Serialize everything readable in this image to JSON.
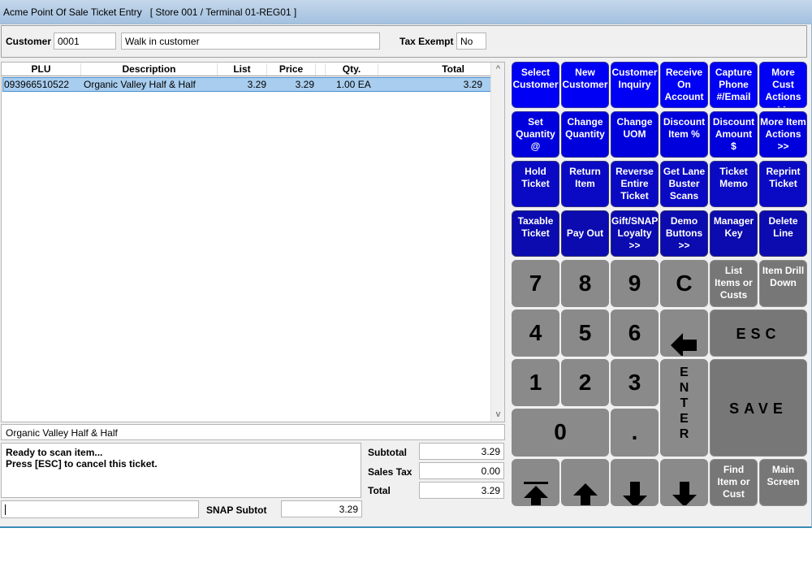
{
  "window": {
    "title": "Acme Point Of Sale Ticket Entry   [ Store 001 / Terminal 01-REG01 ]"
  },
  "customer": {
    "label": "Customer",
    "id": "0001",
    "name": "Walk in customer",
    "tax_exempt_label": "Tax Exempt",
    "tax_exempt_value": "No"
  },
  "grid": {
    "columns": [
      "PLU",
      "Description",
      "List",
      "Price",
      "Qty.",
      "Total"
    ],
    "rows": [
      {
        "plu": "093966510522",
        "description": "Organic Valley Half & Half",
        "list": "3.29",
        "price": "3.29",
        "qty": "1.00 EA",
        "total": "3.29"
      }
    ],
    "scroll_up": "^",
    "scroll_down": "v"
  },
  "selected_description": "Organic Valley Half & Half",
  "messages": {
    "line1": "Ready to scan item...",
    "line2": "Press [ESC] to cancel this ticket."
  },
  "scan_input": {
    "value": ""
  },
  "totals": {
    "subtotal_label": "Subtotal",
    "subtotal": "3.29",
    "sales_tax_label": "Sales Tax",
    "sales_tax": "0.00",
    "total_label": "Total",
    "total": "3.29",
    "snap_label": "SNAP Subtot",
    "snap": "3.29"
  },
  "function_buttons": {
    "row1": [
      "Select\nCustomer",
      "New\nCustomer",
      "Customer\nInquiry",
      "Receive\nOn\nAccount",
      "Capture\nPhone\n#/Email",
      "More Cust\nActions\n>>"
    ],
    "row2": [
      "Set\nQuantity\n@",
      "Change\nQuantity",
      "Change\nUOM",
      "Discount\nItem %",
      "Discount\nAmount\n$",
      "More Item\nActions\n>>"
    ],
    "row3": [
      "Hold\nTicket",
      "Return\nItem",
      "Reverse\nEntire\nTicket",
      "Get Lane\nBuster\nScans",
      "Ticket\nMemo",
      "Reprint\nTicket"
    ],
    "row4": [
      "Taxable\nTicket",
      "Pay Out",
      "Gift/SNAP\nLoyalty\n>>",
      "Demo\nButtons\n>>",
      "Manager\nKey",
      "Delete\nLine"
    ]
  },
  "keypad": {
    "k7": "7",
    "k8": "8",
    "k9": "9",
    "clear": "C",
    "list_items": "List\nItems or\nCusts",
    "item_drill": "Item Drill\nDown",
    "k4": "4",
    "k5": "5",
    "k6": "6",
    "esc": "ESC",
    "k1": "1",
    "k2": "2",
    "k3": "3",
    "enter": "E\nN\nT\nE\nR",
    "save": "SAVE",
    "k0": "0",
    "dot": ".",
    "find": "Find\nItem or\nCust",
    "main_screen": "Main\nScreen"
  },
  "colors": {
    "row1_blue": "#0000f5",
    "row2_blue": "#0000dd",
    "row3_blue": "#0a0ac4",
    "row4_blue": "#0b0bb0",
    "keypad_gray": "#8a8a8a",
    "selection": "#a8cdee"
  }
}
